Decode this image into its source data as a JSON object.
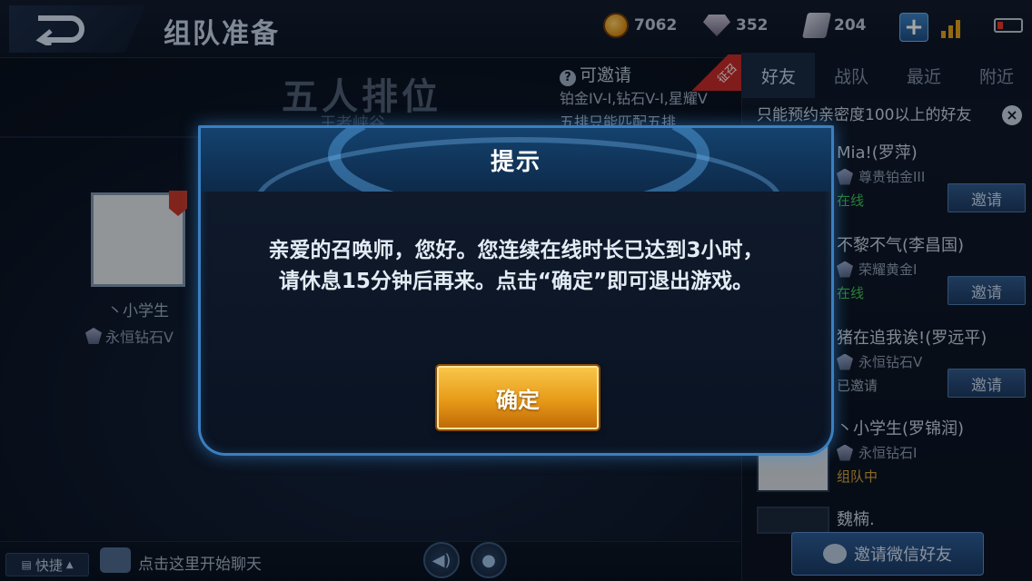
{
  "topbar": {
    "title": "组队准备",
    "gold": "7062",
    "diamonds": "352",
    "vouchers": "204"
  },
  "background": {
    "mode_title": "五人排位",
    "mode_subtitle": "王者峡谷",
    "invite_tip": {
      "head": "可邀请",
      "line1": "铂金IV-I,钻石V-I,星耀V",
      "line2": "五排只能匹配五排"
    },
    "ribbon": "征召",
    "player": {
      "name": "丶小学生",
      "rank": "永恒钻石V"
    }
  },
  "friends": {
    "tabs": [
      "好友",
      "战队",
      "最近",
      "附近"
    ],
    "notice": "只能预约亲密度100以上的好友",
    "list": [
      {
        "name": "Mia!(罗萍)",
        "rank": "尊贵铂金III",
        "status": "在线",
        "action": "邀请"
      },
      {
        "name": "不黎不气(李昌国)",
        "rank": "荣耀黄金I",
        "status": "在线",
        "action": "邀请"
      },
      {
        "name": "猪在追我诶!(罗远平)",
        "rank": "永恒钻石V",
        "status": "已邀请",
        "action": "邀请"
      },
      {
        "name": "丶小学生(罗锦润)",
        "rank": "永恒钻石I",
        "status": "组队中"
      },
      {
        "name": "魏楠."
      }
    ],
    "wechat_invite": "邀请微信好友"
  },
  "chat": {
    "quick": "快捷",
    "placeholder": "点击这里开始聊天"
  },
  "modal": {
    "title": "提示",
    "message_line1": "亲爱的召唤师，您好。您连续在线时长已达到3小时，",
    "message_line2": "请休息15分钟后再来。点击“确定”即可退出游戏。",
    "confirm": "确定"
  },
  "colors": {
    "accent": "#3a7fc0",
    "confirm_button": "#e79a18",
    "online": "#41c356",
    "in_team": "#d3a33a"
  }
}
